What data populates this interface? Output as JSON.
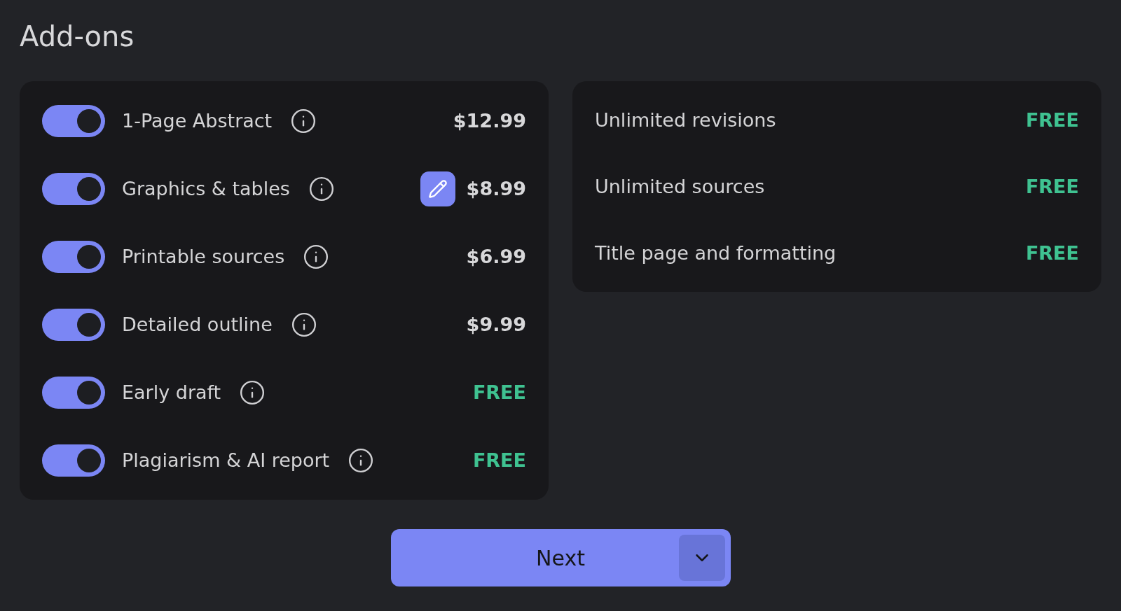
{
  "title": "Add-ons",
  "addons": [
    {
      "label": "1-Page Abstract",
      "price": "$12.99",
      "kind": "paid",
      "on": true,
      "editable": false
    },
    {
      "label": "Graphics & tables",
      "price": "$8.99",
      "kind": "paid",
      "on": true,
      "editable": true
    },
    {
      "label": "Printable sources",
      "price": "$6.99",
      "kind": "paid",
      "on": true,
      "editable": false
    },
    {
      "label": "Detailed outline",
      "price": "$9.99",
      "kind": "paid",
      "on": true,
      "editable": false
    },
    {
      "label": "Early draft",
      "price": "FREE",
      "kind": "free",
      "on": true,
      "editable": false
    },
    {
      "label": "Plagiarism & AI report",
      "price": "FREE",
      "kind": "free",
      "on": true,
      "editable": false
    }
  ],
  "included": [
    {
      "label": "Unlimited revisions",
      "price": "FREE",
      "kind": "free"
    },
    {
      "label": "Unlimited sources",
      "price": "FREE",
      "kind": "free"
    },
    {
      "label": "Title page and formatting",
      "price": "FREE",
      "kind": "free"
    }
  ],
  "next_button": {
    "label": "Next"
  }
}
